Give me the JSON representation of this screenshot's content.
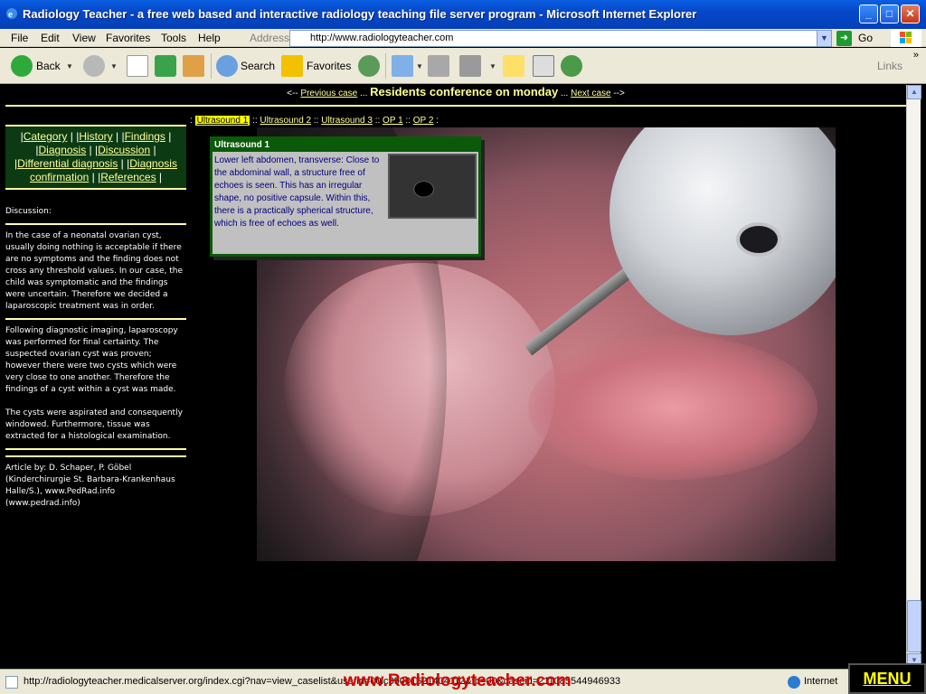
{
  "window": {
    "title": "Radiology Teacher - a free web based and interactive radiology teaching file server program - Microsoft Internet Explorer",
    "minimize": "_",
    "maximize": "□",
    "close": "✕"
  },
  "menubar": {
    "items": [
      "File",
      "Edit",
      "View",
      "Favorites",
      "Tools",
      "Help"
    ],
    "address_label": "Address",
    "address_value": "http://www.radiologyteacher.com",
    "go_label": "Go"
  },
  "toolbar": {
    "back": "Back",
    "search": "Search",
    "favorites": "Favorites",
    "links": "Links"
  },
  "topnav": {
    "prev_prefix": "<-- ",
    "prev": "Previous case",
    "sep1": " ... ",
    "conference": "Residents conference on monday",
    "sep2": " ... ",
    "next": "Next case",
    "next_suffix": " -->"
  },
  "tabs": {
    "items": [
      "Ultrasound 1",
      "Ultrasound 2",
      "Ultrasound 3",
      "OP 1",
      "OP 2"
    ],
    "active": "Ultrasound 1"
  },
  "nav": {
    "items": [
      "Category",
      "History",
      "Findings",
      "Diagnosis",
      "Discussion",
      "Differential diagnosis",
      "Diagnosis confirmation",
      "References"
    ]
  },
  "left": {
    "discussion_heading": "Discussion:",
    "para1": "In the case of a neonatal ovarian cyst, usually doing nothing is acceptable if there are no symptoms and the finding does not cross any threshold values. In our case, the child was symptomatic and the findings were uncertain. Therefore we decided a laparoscopic treatment was in order.",
    "para2": "Following diagnostic imaging, laparoscopy was performed for final certainty. The suspected ovarian cyst was proven; however there were two cysts which were very close to one another. Therefore the findings of a cyst within a cyst was made.",
    "para3": "The cysts were aspirated and consequently windowed. Furthermore, tissue was extracted for a histological examination.",
    "credit": "Article by: D. Schaper, P. Göbel (Kinderchirurgie St. Barbara-Krankenhaus Halle/S.), www.PedRad.info (www.pedrad.info)"
  },
  "popup": {
    "title": "Ultrasound 1",
    "text": "Lower left abdomen, transverse: Close to the abdominal wall, a structure free of echoes is seen. This has an irregular shape, no positive capsule. Within this, there is a practically spherical structure, which is free of echoes as well."
  },
  "statusbar": {
    "url": "http://radiologyteacher.medicalserver.org/index.cgi?nav=view_caselist&userid=00ic39001621404112&tb=00&caseid=211085544946933",
    "watermark": "www.Radiologyteacher.com",
    "zone": "Internet",
    "menu": "MENU"
  },
  "colors": {
    "accent": "#ffff99",
    "nav_bg": "#0c3a12",
    "popup_header": "#0a5a0a",
    "watermark": "#d40000"
  }
}
